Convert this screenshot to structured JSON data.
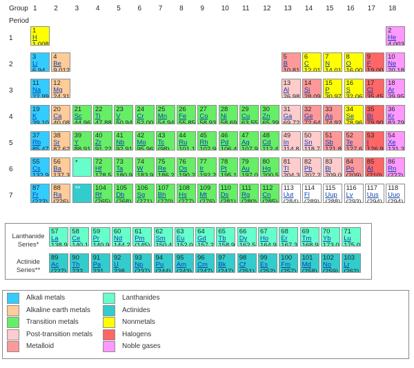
{
  "headers": {
    "group_label": "Group",
    "period_label": "Period",
    "groups": [
      "1",
      "2",
      "3",
      "4",
      "5",
      "6",
      "7",
      "8",
      "9",
      "10",
      "11",
      "12",
      "13",
      "14",
      "15",
      "16",
      "17",
      "18"
    ],
    "periods": [
      "1",
      "2",
      "3",
      "4",
      "5",
      "6",
      "7"
    ]
  },
  "placeholders": {
    "lanthanide_marker": "*",
    "actinide_marker": "**"
  },
  "series_labels": {
    "lanthanide": "Lanthanide Series*",
    "actinide": "Actinide Series**"
  },
  "category_colors": {
    "alkali": "#33ccff",
    "alkaline": "#ffcc99",
    "transition": "#66ee66",
    "post": "#ffcccc",
    "metalloid": "#ff9999",
    "nonmetal": "#ffff00",
    "halogen": "#ff6666",
    "noble": "#ff99ff",
    "lanthanide": "#66ffcc",
    "actinide": "#33cccc",
    "unknown": "#ffffff"
  },
  "elements": [
    {
      "n": "1",
      "s": "H",
      "m": "1.008",
      "g": 1,
      "p": 1,
      "c": "nonmetal"
    },
    {
      "n": "2",
      "s": "He",
      "m": "4.003",
      "g": 18,
      "p": 1,
      "c": "noble"
    },
    {
      "n": "3",
      "s": "Li",
      "m": "6.94",
      "g": 1,
      "p": 2,
      "c": "alkali"
    },
    {
      "n": "4",
      "s": "Be",
      "m": "9.012",
      "g": 2,
      "p": 2,
      "c": "alkaline"
    },
    {
      "n": "5",
      "s": "B",
      "m": "10.81",
      "g": 13,
      "p": 2,
      "c": "metalloid"
    },
    {
      "n": "6",
      "s": "C",
      "m": "12.01",
      "g": 14,
      "p": 2,
      "c": "nonmetal"
    },
    {
      "n": "7",
      "s": "N",
      "m": "14.01",
      "g": 15,
      "p": 2,
      "c": "nonmetal"
    },
    {
      "n": "8",
      "s": "O",
      "m": "16.00",
      "g": 16,
      "p": 2,
      "c": "nonmetal"
    },
    {
      "n": "9",
      "s": "F",
      "m": "19.00",
      "g": 17,
      "p": 2,
      "c": "halogen"
    },
    {
      "n": "10",
      "s": "Ne",
      "m": "20.18",
      "g": 18,
      "p": 2,
      "c": "noble"
    },
    {
      "n": "11",
      "s": "Na",
      "m": "22.99",
      "g": 1,
      "p": 3,
      "c": "alkali"
    },
    {
      "n": "12",
      "s": "Mg",
      "m": "24.31",
      "g": 2,
      "p": 3,
      "c": "alkaline"
    },
    {
      "n": "13",
      "s": "Al",
      "m": "26.98",
      "g": 13,
      "p": 3,
      "c": "post"
    },
    {
      "n": "14",
      "s": "Si",
      "m": "28.09",
      "g": 14,
      "p": 3,
      "c": "metalloid"
    },
    {
      "n": "15",
      "s": "P",
      "m": "30.97",
      "g": 15,
      "p": 3,
      "c": "nonmetal"
    },
    {
      "n": "16",
      "s": "S",
      "m": "32.06",
      "g": 16,
      "p": 3,
      "c": "nonmetal"
    },
    {
      "n": "17",
      "s": "Cl",
      "m": "35.45",
      "g": 17,
      "p": 3,
      "c": "halogen"
    },
    {
      "n": "18",
      "s": "Ar",
      "m": "39.95",
      "g": 18,
      "p": 3,
      "c": "noble"
    },
    {
      "n": "19",
      "s": "K",
      "m": "39.10",
      "g": 1,
      "p": 4,
      "c": "alkali"
    },
    {
      "n": "20",
      "s": "Ca",
      "m": "40.08",
      "g": 2,
      "p": 4,
      "c": "alkaline"
    },
    {
      "n": "21",
      "s": "Sc",
      "m": "44.96",
      "g": 3,
      "p": 4,
      "c": "transition"
    },
    {
      "n": "22",
      "s": "Ti",
      "m": "47.88",
      "g": 4,
      "p": 4,
      "c": "transition"
    },
    {
      "n": "23",
      "s": "V",
      "m": "50.94",
      "g": 5,
      "p": 4,
      "c": "transition"
    },
    {
      "n": "24",
      "s": "Cr",
      "m": "52.00",
      "g": 6,
      "p": 4,
      "c": "transition"
    },
    {
      "n": "25",
      "s": "Mn",
      "m": "54.94",
      "g": 7,
      "p": 4,
      "c": "transition"
    },
    {
      "n": "26",
      "s": "Fe",
      "m": "55.85",
      "g": 8,
      "p": 4,
      "c": "transition"
    },
    {
      "n": "27",
      "s": "Co",
      "m": "58.93",
      "g": 9,
      "p": 4,
      "c": "transition"
    },
    {
      "n": "28",
      "s": "Ni",
      "m": "58.69",
      "g": 10,
      "p": 4,
      "c": "transition"
    },
    {
      "n": "29",
      "s": "Cu",
      "m": "63.55",
      "g": 11,
      "p": 4,
      "c": "transition"
    },
    {
      "n": "30",
      "s": "Zn",
      "m": "65.39",
      "g": 12,
      "p": 4,
      "c": "transition"
    },
    {
      "n": "31",
      "s": "Ga",
      "m": "69.72",
      "g": 13,
      "p": 4,
      "c": "post"
    },
    {
      "n": "32",
      "s": "Ge",
      "m": "72.64",
      "g": 14,
      "p": 4,
      "c": "metalloid"
    },
    {
      "n": "33",
      "s": "As",
      "m": "74.92",
      "g": 15,
      "p": 4,
      "c": "metalloid"
    },
    {
      "n": "34",
      "s": "Se",
      "m": "78.96",
      "g": 16,
      "p": 4,
      "c": "nonmetal"
    },
    {
      "n": "35",
      "s": "Br",
      "m": "79.90",
      "g": 17,
      "p": 4,
      "c": "halogen"
    },
    {
      "n": "36",
      "s": "Kr",
      "m": "83.79",
      "g": 18,
      "p": 4,
      "c": "noble"
    },
    {
      "n": "37",
      "s": "Rb",
      "m": "85.47",
      "g": 1,
      "p": 5,
      "c": "alkali"
    },
    {
      "n": "38",
      "s": "Sr",
      "m": "87.62",
      "g": 2,
      "p": 5,
      "c": "alkaline"
    },
    {
      "n": "39",
      "s": "Y",
      "m": "88.91",
      "g": 3,
      "p": 5,
      "c": "transition"
    },
    {
      "n": "40",
      "s": "Zr",
      "m": "91.22",
      "g": 4,
      "p": 5,
      "c": "transition"
    },
    {
      "n": "41",
      "s": "Nb",
      "m": "92.91",
      "g": 5,
      "p": 5,
      "c": "transition"
    },
    {
      "n": "42",
      "s": "Mo",
      "m": "95.96",
      "g": 6,
      "p": 5,
      "c": "transition"
    },
    {
      "n": "43",
      "s": "Tc",
      "m": "(98)",
      "g": 7,
      "p": 5,
      "c": "transition"
    },
    {
      "n": "44",
      "s": "Ru",
      "m": "101.1",
      "g": 8,
      "p": 5,
      "c": "transition"
    },
    {
      "n": "45",
      "s": "Rh",
      "m": "102.9",
      "g": 9,
      "p": 5,
      "c": "transition"
    },
    {
      "n": "46",
      "s": "Pd",
      "m": "106.4",
      "g": 10,
      "p": 5,
      "c": "transition"
    },
    {
      "n": "47",
      "s": "Ag",
      "m": "107.9",
      "g": 11,
      "p": 5,
      "c": "transition"
    },
    {
      "n": "48",
      "s": "Cd",
      "m": "112.4",
      "g": 12,
      "p": 5,
      "c": "transition"
    },
    {
      "n": "49",
      "s": "In",
      "m": "114.8",
      "g": 13,
      "p": 5,
      "c": "post"
    },
    {
      "n": "50",
      "s": "Sn",
      "m": "118.7",
      "g": 14,
      "p": 5,
      "c": "post"
    },
    {
      "n": "51",
      "s": "Sb",
      "m": "121.8",
      "g": 15,
      "p": 5,
      "c": "metalloid"
    },
    {
      "n": "52",
      "s": "Te",
      "m": "127.6",
      "g": 16,
      "p": 5,
      "c": "metalloid"
    },
    {
      "n": "53",
      "s": "I",
      "m": "126.9",
      "g": 17,
      "p": 5,
      "c": "halogen"
    },
    {
      "n": "54",
      "s": "Xe",
      "m": "131.3",
      "g": 18,
      "p": 5,
      "c": "noble"
    },
    {
      "n": "55",
      "s": "Cs",
      "m": "132.9",
      "g": 1,
      "p": 6,
      "c": "alkali"
    },
    {
      "n": "56",
      "s": "Ba",
      "m": "137.3",
      "g": 2,
      "p": 6,
      "c": "alkaline"
    },
    {
      "n": "72",
      "s": "Hf",
      "m": "178.5",
      "g": 4,
      "p": 6,
      "c": "transition"
    },
    {
      "n": "73",
      "s": "Ta",
      "m": "180.9",
      "g": 5,
      "p": 6,
      "c": "transition"
    },
    {
      "n": "74",
      "s": "W",
      "m": "183.9",
      "g": 6,
      "p": 6,
      "c": "transition"
    },
    {
      "n": "75",
      "s": "Re",
      "m": "186.2",
      "g": 7,
      "p": 6,
      "c": "transition"
    },
    {
      "n": "76",
      "s": "Os",
      "m": "190.2",
      "g": 8,
      "p": 6,
      "c": "transition"
    },
    {
      "n": "77",
      "s": "Ir",
      "m": "192.2",
      "g": 9,
      "p": 6,
      "c": "transition"
    },
    {
      "n": "78",
      "s": "Pt",
      "m": "195.1",
      "g": 10,
      "p": 6,
      "c": "transition"
    },
    {
      "n": "79",
      "s": "Au",
      "m": "197.0",
      "g": 11,
      "p": 6,
      "c": "transition"
    },
    {
      "n": "80",
      "s": "Hg",
      "m": "200.5",
      "g": 12,
      "p": 6,
      "c": "transition"
    },
    {
      "n": "81",
      "s": "Tl",
      "m": "204.38",
      "g": 13,
      "p": 6,
      "c": "post"
    },
    {
      "n": "82",
      "s": "Pb",
      "m": "207.2",
      "g": 14,
      "p": 6,
      "c": "post"
    },
    {
      "n": "83",
      "s": "Bi",
      "m": "209.0",
      "g": 15,
      "p": 6,
      "c": "post"
    },
    {
      "n": "84",
      "s": "Po",
      "m": "(209)",
      "g": 16,
      "p": 6,
      "c": "metalloid"
    },
    {
      "n": "85",
      "s": "At",
      "m": "(210)",
      "g": 17,
      "p": 6,
      "c": "halogen"
    },
    {
      "n": "86",
      "s": "Rn",
      "m": "(222)",
      "g": 18,
      "p": 6,
      "c": "noble"
    },
    {
      "n": "87",
      "s": "Fr",
      "m": "(223)",
      "g": 1,
      "p": 7,
      "c": "alkali"
    },
    {
      "n": "88",
      "s": "Ra",
      "m": "(226)",
      "g": 2,
      "p": 7,
      "c": "alkaline"
    },
    {
      "n": "104",
      "s": "Rf",
      "m": "(265)",
      "g": 4,
      "p": 7,
      "c": "transition"
    },
    {
      "n": "105",
      "s": "Db",
      "m": "(268)",
      "g": 5,
      "p": 7,
      "c": "transition"
    },
    {
      "n": "106",
      "s": "Sg",
      "m": "(271)",
      "g": 6,
      "p": 7,
      "c": "transition"
    },
    {
      "n": "107",
      "s": "Bh",
      "m": "(270)",
      "g": 7,
      "p": 7,
      "c": "transition"
    },
    {
      "n": "108",
      "s": "Hs",
      "m": "(277)",
      "g": 8,
      "p": 7,
      "c": "transition"
    },
    {
      "n": "109",
      "s": "Mt",
      "m": "(276)",
      "g": 9,
      "p": 7,
      "c": "transition"
    },
    {
      "n": "110",
      "s": "Ds",
      "m": "(281)",
      "g": 10,
      "p": 7,
      "c": "transition"
    },
    {
      "n": "111",
      "s": "Rg",
      "m": "(280)",
      "g": 11,
      "p": 7,
      "c": "transition"
    },
    {
      "n": "112",
      "s": "Cn",
      "m": "(285)",
      "g": 12,
      "p": 7,
      "c": "transition"
    },
    {
      "n": "113",
      "s": "Uut",
      "m": "(284)",
      "g": 13,
      "p": 7,
      "c": "unknown"
    },
    {
      "n": "114",
      "s": "Fl",
      "m": "(289)",
      "g": 14,
      "p": 7,
      "c": "unknown"
    },
    {
      "n": "115",
      "s": "Uup",
      "m": "(288)",
      "g": 15,
      "p": 7,
      "c": "unknown"
    },
    {
      "n": "116",
      "s": "Lv",
      "m": "(293)",
      "g": 16,
      "p": 7,
      "c": "unknown"
    },
    {
      "n": "117",
      "s": "Uus",
      "m": "(294)",
      "g": 17,
      "p": 7,
      "c": "unknown"
    },
    {
      "n": "118",
      "s": "Uuo",
      "m": "(294)",
      "g": 18,
      "p": 7,
      "c": "unknown"
    }
  ],
  "lanthanides": [
    {
      "n": "57",
      "s": "La",
      "m": "138.9"
    },
    {
      "n": "58",
      "s": "Ce",
      "m": "140.1"
    },
    {
      "n": "59",
      "s": "Pr",
      "m": "140.9"
    },
    {
      "n": "60",
      "s": "Nd",
      "m": "144.2"
    },
    {
      "n": "61",
      "s": "Pm",
      "m": "(145)"
    },
    {
      "n": "62",
      "s": "Sm",
      "m": "150.4"
    },
    {
      "n": "63",
      "s": "Eu",
      "m": "152.0"
    },
    {
      "n": "64",
      "s": "Gd",
      "m": "157.2"
    },
    {
      "n": "65",
      "s": "Tb",
      "m": "158.9"
    },
    {
      "n": "66",
      "s": "Dy",
      "m": "162.5"
    },
    {
      "n": "67",
      "s": "Ho",
      "m": "164.9"
    },
    {
      "n": "68",
      "s": "Er",
      "m": "167.3"
    },
    {
      "n": "69",
      "s": "Tm",
      "m": "168.9"
    },
    {
      "n": "70",
      "s": "Yb",
      "m": "173.0"
    },
    {
      "n": "71",
      "s": "Lu",
      "m": "175.0"
    }
  ],
  "actinides": [
    {
      "n": "89",
      "s": "Ac",
      "m": "(227)"
    },
    {
      "n": "90",
      "s": "Th",
      "m": "232"
    },
    {
      "n": "91",
      "s": "Pa",
      "m": "231"
    },
    {
      "n": "92",
      "s": "U",
      "m": "238"
    },
    {
      "n": "93",
      "s": "Np",
      "m": "(237)"
    },
    {
      "n": "94",
      "s": "Pu",
      "m": "(244)"
    },
    {
      "n": "95",
      "s": "Am",
      "m": "(243)"
    },
    {
      "n": "96",
      "s": "Cm",
      "m": "(247)"
    },
    {
      "n": "97",
      "s": "Bk",
      "m": "(247)"
    },
    {
      "n": "98",
      "s": "Cf",
      "m": "(251)"
    },
    {
      "n": "99",
      "s": "Es",
      "m": "(252)"
    },
    {
      "n": "100",
      "s": "Fm",
      "m": "(257)"
    },
    {
      "n": "101",
      "s": "Md",
      "m": "(258)"
    },
    {
      "n": "102",
      "s": "No",
      "m": "(259)"
    },
    {
      "n": "103",
      "s": "Lr",
      "m": "(262)"
    }
  ],
  "legend": [
    {
      "label": "Alkali metals",
      "c": "alkali"
    },
    {
      "label": "Lanthanides",
      "c": "lanthanide"
    },
    {
      "label": "Alkaline earth metals",
      "c": "alkaline"
    },
    {
      "label": "Actinides",
      "c": "actinide"
    },
    {
      "label": "Transition metals",
      "c": "transition"
    },
    {
      "label": "Nonmetals",
      "c": "nonmetal"
    },
    {
      "label": "Post-transition metals",
      "c": "post"
    },
    {
      "label": "Halogens",
      "c": "halogen"
    },
    {
      "label": "Metalloid",
      "c": "metalloid"
    },
    {
      "label": "Noble gases",
      "c": "noble"
    }
  ]
}
